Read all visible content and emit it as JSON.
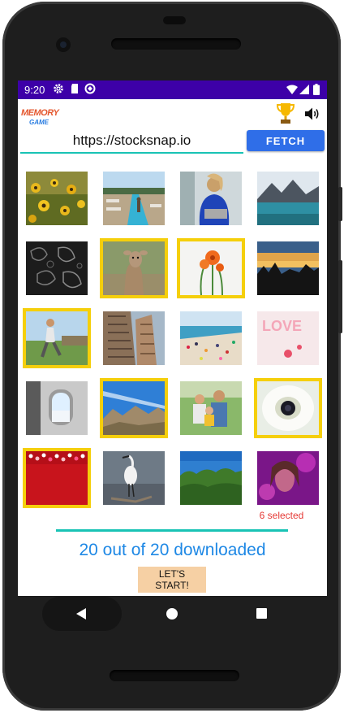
{
  "status_bar": {
    "time": "9:20",
    "icons": [
      "gear-icon",
      "sd-card-icon",
      "sync-icon"
    ],
    "right_icons": [
      "wifi-icon",
      "signal-icon",
      "battery-icon"
    ],
    "color": "#3d00a8"
  },
  "header": {
    "logo_line1": "MEMORY",
    "logo_line2": "GAME",
    "trophy_icon": "trophy-icon",
    "sound_icon": "speaker-icon"
  },
  "fetch": {
    "url_value": "https://stocksnap.io",
    "button_label": "FETCH",
    "accent": "#2f6ee8"
  },
  "grid": {
    "selected_color": "#f5cf0b",
    "images": [
      {
        "subject": "yellow flowers",
        "selected": false
      },
      {
        "subject": "pool with person",
        "selected": false
      },
      {
        "subject": "woman with laptop",
        "selected": false
      },
      {
        "subject": "mountain lake",
        "selected": false
      },
      {
        "subject": "black paisley pattern",
        "selected": false
      },
      {
        "subject": "deer",
        "selected": true
      },
      {
        "subject": "orange flowers",
        "selected": true
      },
      {
        "subject": "sunset over trees",
        "selected": false
      },
      {
        "subject": "woman jogging",
        "selected": true
      },
      {
        "subject": "tall buildings",
        "selected": false
      },
      {
        "subject": "crowded beach",
        "selected": false
      },
      {
        "subject": "pink love letters",
        "selected": false
      },
      {
        "subject": "airplane window",
        "selected": false
      },
      {
        "subject": "rocky hills and sky",
        "selected": true
      },
      {
        "subject": "family outdoors",
        "selected": false
      },
      {
        "subject": "white flower closeup",
        "selected": true
      },
      {
        "subject": "red background with hearts",
        "selected": true
      },
      {
        "subject": "heron",
        "selected": false
      },
      {
        "subject": "forest landscape",
        "selected": false
      },
      {
        "subject": "woman with purple lights",
        "selected": false
      }
    ]
  },
  "footer": {
    "selected_text": "6 selected",
    "downloaded_text": "20 out of 20 downloaded",
    "download_progress": 1.0,
    "start_label": "LET'S START!"
  },
  "navbar": {
    "back_icon": "back-triangle-icon",
    "home_icon": "home-circle-icon",
    "recents_icon": "recents-square-icon"
  }
}
